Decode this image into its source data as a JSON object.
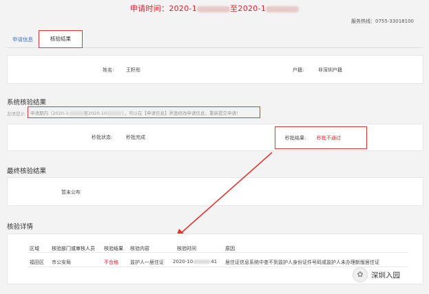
{
  "header": {
    "title_prefix": "申请时间：2020-1",
    "title_mid": "至2020-1"
  },
  "hotline": "服务热线：0755-33018100",
  "tabs": [
    {
      "label": "申请信息"
    },
    {
      "label": "核验结果"
    }
  ],
  "person": {
    "name_label": "姓名:",
    "name_value": "王籽彤",
    "hukou_label": "户籍:",
    "hukou_value": "非深圳户籍"
  },
  "system_result": {
    "section_title": "系统核验结果",
    "hint_label": "友情提示",
    "hint_text": "申请期内（2020-1",
    "hint_text_mid": "至2020-10",
    "hint_text_end": "），可以在【申请信息】界面修改申请信息，重新提交申请！",
    "status_label": "秒批状态:",
    "status_value": "秒批完成",
    "result_label": "秒批结果:",
    "result_value": "秒批不通过"
  },
  "final_result": {
    "section_title": "最终核验结果",
    "value": "暂未公布"
  },
  "details": {
    "section_title": "核验详情",
    "columns": [
      "区域",
      "核验部门或审核人员",
      "核验结果",
      "核验内容",
      "核验时间",
      "原因"
    ],
    "rows": [
      {
        "area": "福田区",
        "dept": "市公安局",
        "result": "不合格",
        "content": "监护人一居住证",
        "time": "2020-10",
        "time_tail": "41",
        "reason": "居住证信息系统中查不到监护人身份证件号码或监护人未办理新版居住证"
      }
    ]
  },
  "watermark": {
    "text": "深圳入园",
    "icon": "wechat-icon"
  }
}
